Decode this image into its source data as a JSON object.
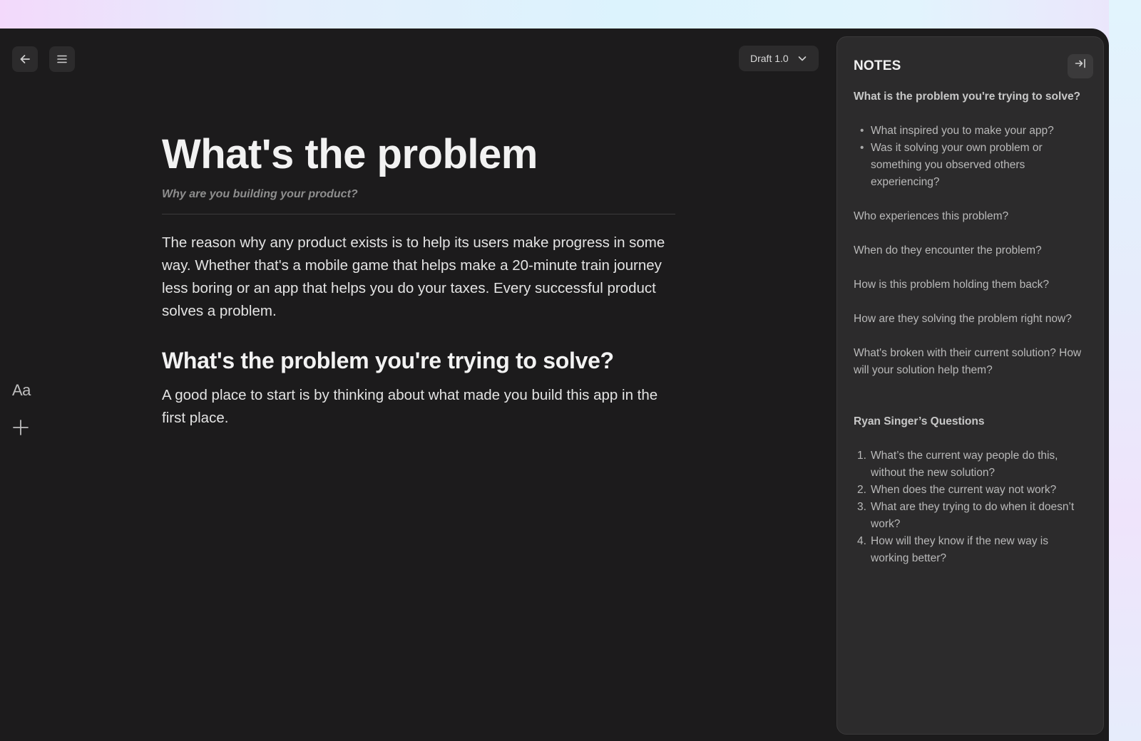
{
  "toolbar": {
    "back_icon": "arrow-left-icon",
    "menu_icon": "hamburger-menu-icon",
    "draft_version": "Draft 1.0",
    "draft_chevron_icon": "chevron-down-icon"
  },
  "side_tools": {
    "font_tool_label": "Aa",
    "add_icon": "plus-icon"
  },
  "document": {
    "title": "What's the problem",
    "subtitle": "Why are you building your product?",
    "intro": "The reason why any product exists is to help its users make progress in some way. Whether that's a mobile game that helps make a 20-minute train journey less boring or an app that helps you do your taxes. Every successful product solves a problem.",
    "section_heading": "What's the problem you're trying to solve?",
    "section_body": "A good place to start is by thinking about what made you build this app in the first place."
  },
  "notes": {
    "title": "NOTES",
    "collapse_icon": "collapse-right-icon",
    "heading_1": "What is the problem you're trying to solve?",
    "bullets": [
      "What inspired you to make your app?",
      "Was it solving your own problem or something you observed others experiencing?"
    ],
    "paragraphs": [
      "Who experiences this problem?",
      "When do they encounter the problem?",
      "How is this problem holding them back?",
      "How are they solving the problem right now?",
      "What's broken with their current solution? How will your solution help them?"
    ],
    "heading_2": "Ryan Singer’s Questions",
    "numbered": [
      "What’s the current way people do this, without the new solution?",
      "When does the current way not work?",
      "What are they trying to do when it doesn’t work?",
      "How will they know if the new way is working better?"
    ]
  },
  "colors": {
    "app_background": "#1c1b1c",
    "panel_background": "#2c2b2c",
    "text_primary": "#f2f2f2",
    "text_muted": "#8e8e8e"
  }
}
